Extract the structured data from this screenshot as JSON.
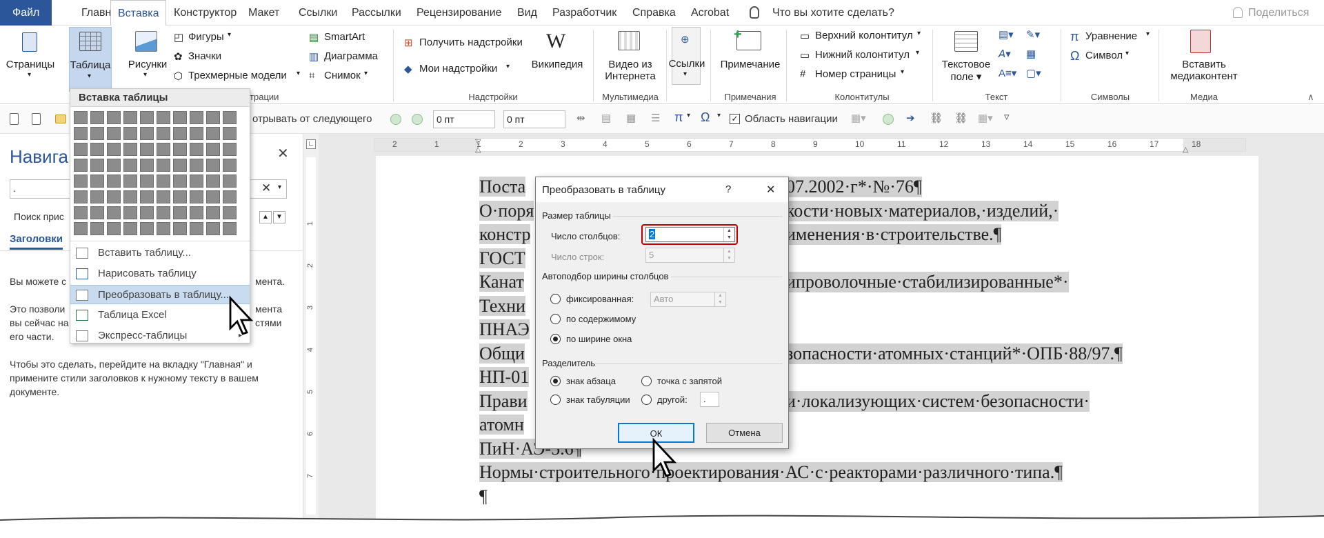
{
  "menu": {
    "file": "Файл",
    "tabs": [
      "Главная",
      "Вставка",
      "Конструктор",
      "Макет",
      "Ссылки",
      "Рассылки",
      "Рецензирование",
      "Вид",
      "Разработчик",
      "Справка",
      "Acrobat"
    ],
    "active_tab": "Вставка",
    "tell_me": "Что вы хотите сделать?",
    "share": "Поделиться"
  },
  "ribbon": {
    "pages": "Страницы",
    "table": "Таблица",
    "pictures": "Рисунки",
    "shapes": "Фигуры",
    "icons": "Значки",
    "models3d": "Трехмерные модели",
    "smartart": "SmartArt",
    "chart": "Диаграмма",
    "screenshot": "Снимок",
    "illustrations_group": "страции",
    "get_addins": "Получить надстройки",
    "my_addins": "Мои надстройки",
    "wikipedia": "Википедия",
    "addins_group": "Надстройки",
    "online_video_1": "Видео из",
    "online_video_2": "Интернета",
    "media_group": "Мультимедиа",
    "links": "Ссылки",
    "comment": "Примечание",
    "comments_group": "Примечания",
    "header": "Верхний колонтитул",
    "footer": "Нижний колонтитул",
    "page_number": "Номер страницы",
    "hf_group": "Колонтитулы",
    "textbox_1": "Текстовое",
    "textbox_2": "поле",
    "text_group": "Текст",
    "equation": "Уравнение",
    "symbol": "Символ",
    "symbols_group": "Символы",
    "insert_media_1": "Вставить",
    "insert_media_2": "медиаконтент",
    "media2_group": "Медиа"
  },
  "qa": {
    "keep_with_next": "отрывать от следующего",
    "spacing_before": "0 пт",
    "spacing_after": "0 пт",
    "nav_pane_label": "Область навигации"
  },
  "nav": {
    "title": "Навига",
    "search_value": ".",
    "search_hint": "Поиск прис",
    "tab_headings": "Заголовки",
    "p1": "Вы можете с",
    "p1_tail": "мента.",
    "p2a": "Это позволи",
    "p2a_tail": "мента",
    "p2b": "вы сейчас на",
    "p2b_tail": "стями",
    "p2c": "его части.",
    "p3a": "Чтобы это сделать, перейдите на вкладку \"Главная\" и",
    "p3b": "примените стили заголовков к нужному тексту в вашем",
    "p3c": "документе."
  },
  "ruler_h": [
    "2",
    "1",
    "1",
    "2",
    "3",
    "4",
    "5",
    "6",
    "7",
    "8",
    "9",
    "10",
    "11",
    "12",
    "13",
    "14",
    "15",
    "16",
    "17",
    "18"
  ],
  "ruler_v": [
    "1",
    "2",
    "3",
    "4",
    "5",
    "6",
    "7"
  ],
  "document": {
    "lines": [
      {
        "a": "Поста",
        "b": "07.2002·г*·№·76¶"
      },
      {
        "a": "О·поря",
        "b": "кости·новых·материалов,·изделий,·"
      },
      {
        "a": "констр",
        "b": "именения·в·строительстве.¶"
      },
      {
        "a": "ГОСТ",
        "b": ""
      },
      {
        "a": "Канат",
        "b": "ипроволочные·стабилизированные*·"
      },
      {
        "a": "Техни",
        "b": ""
      },
      {
        "a": "ПНАЭ",
        "b": ""
      },
      {
        "a": "Общи",
        "b": "зопасности·атомных·станций*·ОПБ·88/97.¶"
      },
      {
        "a": "НП-01",
        "b": ""
      },
      {
        "a": "Прави",
        "b": "и·локализующих·систем·безопасности·"
      },
      {
        "a": "атомн",
        "b": ""
      },
      {
        "a": "ПиН·АЭ-5.6¶",
        "b": ""
      },
      {
        "a": "Нормы·строительного·проектирования·АС·с·реакторами·различного·типа.¶",
        "b": ""
      },
      {
        "a": "¶",
        "b": ""
      }
    ]
  },
  "table_menu": {
    "title": "Вставка таблицы",
    "items": [
      "Вставить таблицу...",
      "Нарисовать таблицу",
      "Преобразовать в таблицу...",
      "Таблица Excel",
      "Экспресс-таблицы"
    ]
  },
  "dialog": {
    "title": "Преобразовать в таблицу",
    "help": "?",
    "close": "✕",
    "size_group": "Размер таблицы",
    "cols_label": "Число столбцов:",
    "cols_value": "2",
    "rows_label": "Число строк:",
    "rows_value": "5",
    "autofit_group": "Автоподбор ширины столбцов",
    "fixed": "фиксированная:",
    "fixed_value": "Авто",
    "by_content": "по содержимому",
    "by_window": "по ширине окна",
    "sep_group": "Разделитель",
    "sep_paragraph": "знак абзаца",
    "sep_semicolon": "точка с запятой",
    "sep_tab": "знак табуляции",
    "sep_other": "другой:",
    "sep_other_value": ".",
    "ok": "ОК",
    "cancel": "Отмена"
  },
  "colors": {
    "file_tab": "#2b579a",
    "highlight_red": "#c00000",
    "selection": "#d2d2d2"
  }
}
